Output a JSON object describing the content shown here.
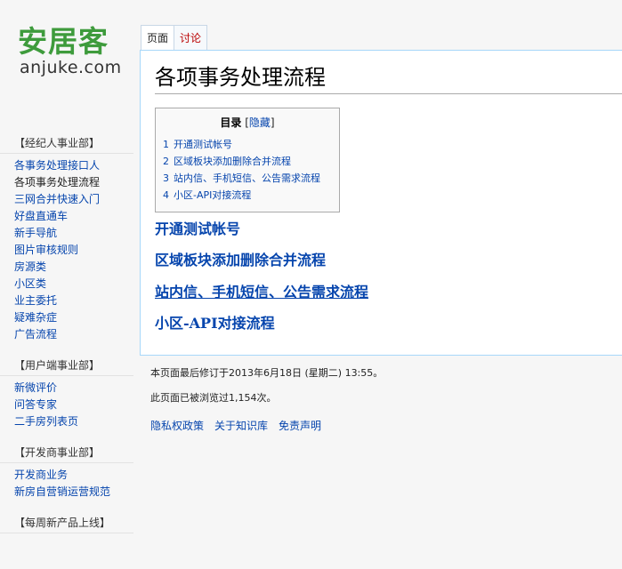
{
  "logo": {
    "cn": "安居客",
    "en": "anjuke.com"
  },
  "sidebar": {
    "portals": [
      {
        "title": "【经纪人事业部】",
        "items": [
          "各事务处理接口人",
          "各项事务处理流程",
          "三网合并快速入门",
          "好盘直通车",
          "新手导航",
          "图片审核规则",
          "房源类",
          "小区类",
          "业主委托",
          "疑难杂症",
          "广告流程"
        ],
        "current": 1
      },
      {
        "title": "【用户端事业部】",
        "items": [
          "新微评价",
          "问答专家",
          "二手房列表页"
        ],
        "current": -1
      },
      {
        "title": "【开发商事业部】",
        "items": [
          "开发商业务",
          "新房自营销运营规范"
        ],
        "current": -1
      },
      {
        "title": "【每周新产品上线】",
        "items": [],
        "current": -1
      }
    ]
  },
  "tabs": {
    "page": "页面",
    "discuss": "讨论"
  },
  "page": {
    "title": "各项事务处理流程",
    "toc": {
      "title": "目录",
      "bracket_open": "[",
      "hide": "隐藏",
      "bracket_close": "]",
      "items": [
        {
          "num": "1",
          "label": "开通测试帐号"
        },
        {
          "num": "2",
          "label": "区域板块添加删除合并流程"
        },
        {
          "num": "3",
          "label": "站内信、手机短信、公告需求流程"
        },
        {
          "num": "4",
          "label": "小区-API对接流程"
        }
      ]
    },
    "sections": [
      "开通测试帐号",
      "区域板块添加删除合并流程",
      "站内信、手机短信、公告需求流程",
      "小区-API对接流程"
    ]
  },
  "footer": {
    "last_modified": "本页面最后修订于2013年6月18日 (星期二) 13:55。",
    "views": "此页面已被浏览过1,154次。",
    "links": [
      "隐私权政策",
      "关于知识库",
      "免责声明"
    ]
  }
}
